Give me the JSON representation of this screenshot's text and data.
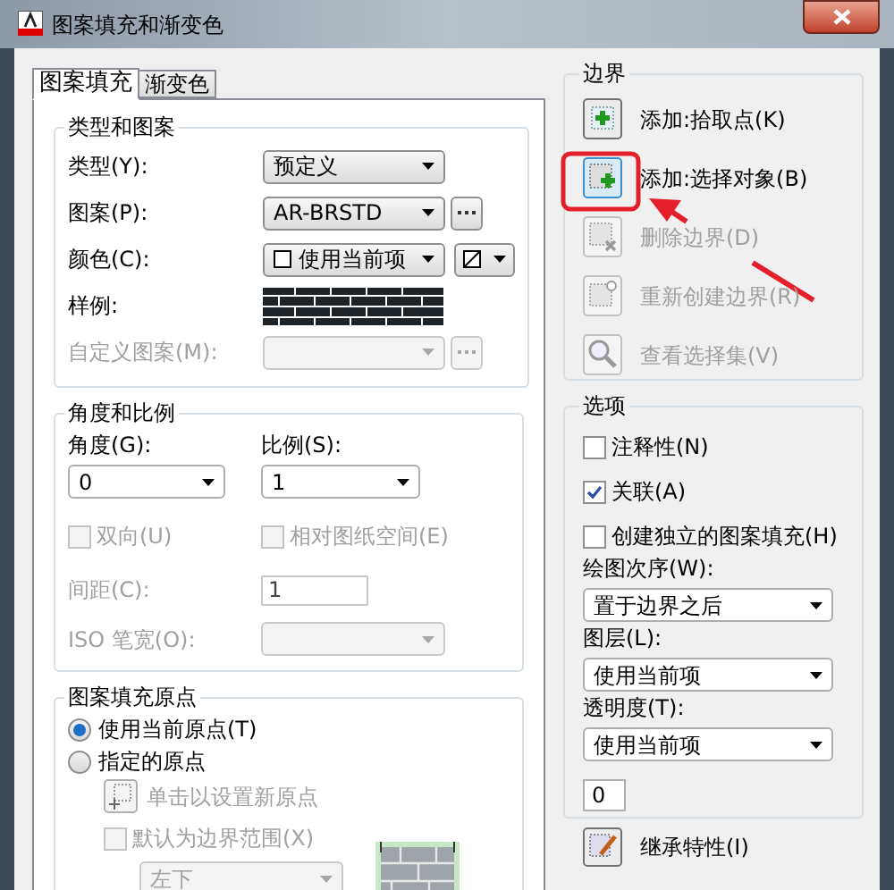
{
  "window": {
    "title": "图案填充和渐变色"
  },
  "tabs": [
    {
      "label": "图案填充",
      "selected": true
    },
    {
      "label": "渐变色",
      "selected": false
    }
  ],
  "type_and_pattern": {
    "title": "类型和图案",
    "fields": [
      {
        "kind": "dropdown",
        "label": "类型(Y):",
        "value": "预定义",
        "disabled": false
      },
      {
        "kind": "dropdown_browse",
        "label": "图案(P):",
        "value": "AR-BRSTD",
        "disabled": false
      },
      {
        "kind": "color",
        "label": "颜色(C):",
        "value": "使用当前项",
        "disabled": false
      },
      {
        "kind": "swatch",
        "label": "样例:",
        "disabled": false
      },
      {
        "kind": "dropdown_browse",
        "label": "自定义图案(M):",
        "disabled": true
      }
    ]
  },
  "angle_and_scale": {
    "title": "角度和比例",
    "angle": {
      "label": "角度(G):",
      "value": "0"
    },
    "scale": {
      "label": "比例(S):",
      "value": "1"
    },
    "checkboxes": [
      {
        "label": "双向(U)",
        "checked": false,
        "disabled": true
      },
      {
        "label": "相对图纸空间(E)",
        "checked": false,
        "disabled": true
      }
    ],
    "spacing": {
      "label": "间距(C):",
      "value": "1",
      "disabled": true
    },
    "iso_pen_width": {
      "label": "ISO 笔宽(O):",
      "disabled": true
    }
  },
  "hatch_origin": {
    "title": "图案填充原点",
    "options": [
      {
        "label": "使用当前原点(T)",
        "selected": true
      },
      {
        "label": "指定的原点",
        "selected": false
      }
    ],
    "set_origin_button": {
      "label": "单击以设置新原点",
      "disabled": true
    },
    "default_to_boundary": {
      "label": "默认为边界范围(X)",
      "checked": false,
      "disabled": true
    },
    "position": {
      "value": "左下",
      "disabled": true
    }
  },
  "boundaries": {
    "title": "边界",
    "buttons": [
      {
        "kind": "pick",
        "label": "添加:拾取点(K)",
        "disabled": false,
        "focused": false
      },
      {
        "kind": "select",
        "label": "添加:选择对象(B)",
        "disabled": false,
        "focused": true
      },
      {
        "kind": "remove",
        "label": "删除边界(D)",
        "disabled": true,
        "focused": false
      },
      {
        "kind": "recreate",
        "label": "重新创建边界(R)",
        "disabled": true,
        "focused": false
      },
      {
        "kind": "view",
        "label": "查看选择集(V)",
        "disabled": true,
        "focused": false
      }
    ]
  },
  "options": {
    "title": "选项",
    "checkboxes": [
      {
        "label": "注释性(N)",
        "checked": false
      },
      {
        "label": "关联(A)",
        "checked": true
      },
      {
        "label": "创建独立的图案填充(H)",
        "checked": false
      }
    ],
    "draw_order": {
      "label": "绘图次序(W):",
      "value": "置于边界之后"
    },
    "layer": {
      "label": "图层(L):",
      "value": "使用当前项"
    },
    "transparency": {
      "label": "透明度(T):",
      "value": "使用当前项",
      "amount": "0"
    }
  },
  "inherit_button": {
    "label": "继承特性(I)"
  }
}
